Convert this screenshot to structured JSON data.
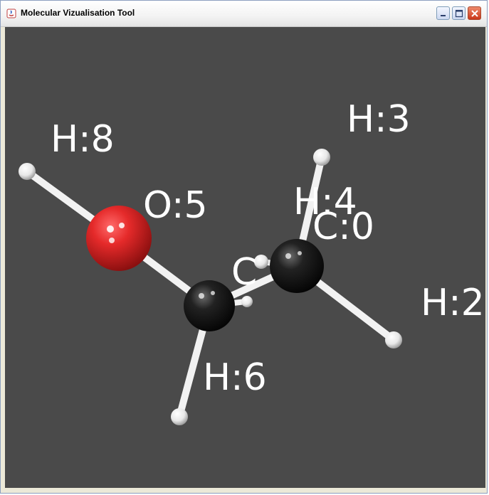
{
  "window": {
    "title": "Molecular Vizualisation Tool",
    "buttons": {
      "minimize": "minimize-icon",
      "maximize": "maximize-icon",
      "close": "close-icon"
    }
  },
  "viewer": {
    "background_color": "#4a4a4a",
    "atom_colors": {
      "carbon": "#111111",
      "oxygen": "#e0202a",
      "hydrogen": "#ffffff"
    },
    "labels": {
      "h8": "H:8",
      "o5": "O:5",
      "h3": "H:3",
      "h4": "H:4",
      "c0": "C:0",
      "c1": "C",
      "h2": "H:2",
      "h6": "H:6"
    }
  }
}
